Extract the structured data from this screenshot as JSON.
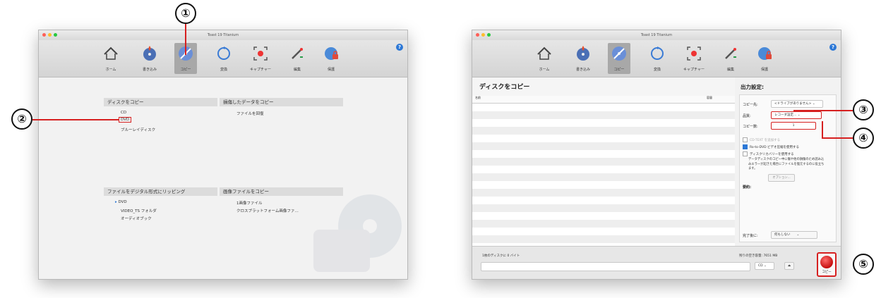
{
  "left_window": {
    "title": "Toast 19 Titanium",
    "toolbar": [
      {
        "label": "ホーム",
        "icon": "home-icon"
      },
      {
        "label": "書き込み",
        "icon": "burn-disc-icon"
      },
      {
        "label": "コピー",
        "icon": "copy-disc-icon",
        "active": true
      },
      {
        "label": "変換",
        "icon": "convert-icon"
      },
      {
        "label": "キャプチャー",
        "icon": "capture-icon"
      },
      {
        "label": "編集",
        "icon": "edit-icon"
      },
      {
        "label": "保護",
        "icon": "protect-icon"
      }
    ],
    "sections": [
      {
        "heading": "ディスクをコピー",
        "items": [
          "CD",
          "DVD",
          "ブルーレイディスク"
        ]
      },
      {
        "heading": "損傷したデータをコピー",
        "items": [
          "ファイルを回復"
        ]
      },
      {
        "heading": "ファイルをデジタル形式にリッピング",
        "items": [
          "DVD",
          "VIDEO_TS フォルダ",
          "オーディオブック"
        ]
      },
      {
        "heading": "画像ファイルをコピー",
        "items": [
          "1画像ファイル",
          "クロスプラットフォーム画像ファ…"
        ]
      }
    ]
  },
  "right_window": {
    "title": "Toast 19 Titanium",
    "pane_title": "ディスクをコピー",
    "list_header": {
      "name": "名前",
      "size": "容量"
    },
    "output_title": "出力設定:",
    "fields": {
      "copy_to_label": "コピー先:",
      "copy_to_value": "<ドライブがありません>",
      "quality_label": "品質:",
      "quality_value": "レコーダ設定...",
      "copies_label": "コピー数:",
      "copies_value": "1"
    },
    "checks": [
      {
        "label": "CD-TEXT を追加する",
        "checked": false
      },
      {
        "label": "Ro-to-DVD ビデオ圧縮を使用する",
        "checked": true
      },
      {
        "label": "ディスクリカバリーを使用する",
        "checked": false
      }
    ],
    "description": "データディスクのコピー中に傷や他の損傷のため読み込みエラーが起きた場合にファイルを復元するのに役立ちます。",
    "option_button": "オプション...",
    "summary_label": "要約:",
    "after_label": "完了後に:",
    "after_value": "何もしない",
    "bottom": {
      "left_text": "1枚のディスクに 0 バイト",
      "right_text": "残りの空き容量: 7651 MB",
      "drive_select": "CD",
      "record_label": "コピー"
    }
  },
  "callouts": [
    "①",
    "②",
    "③",
    "④",
    "⑤"
  ]
}
